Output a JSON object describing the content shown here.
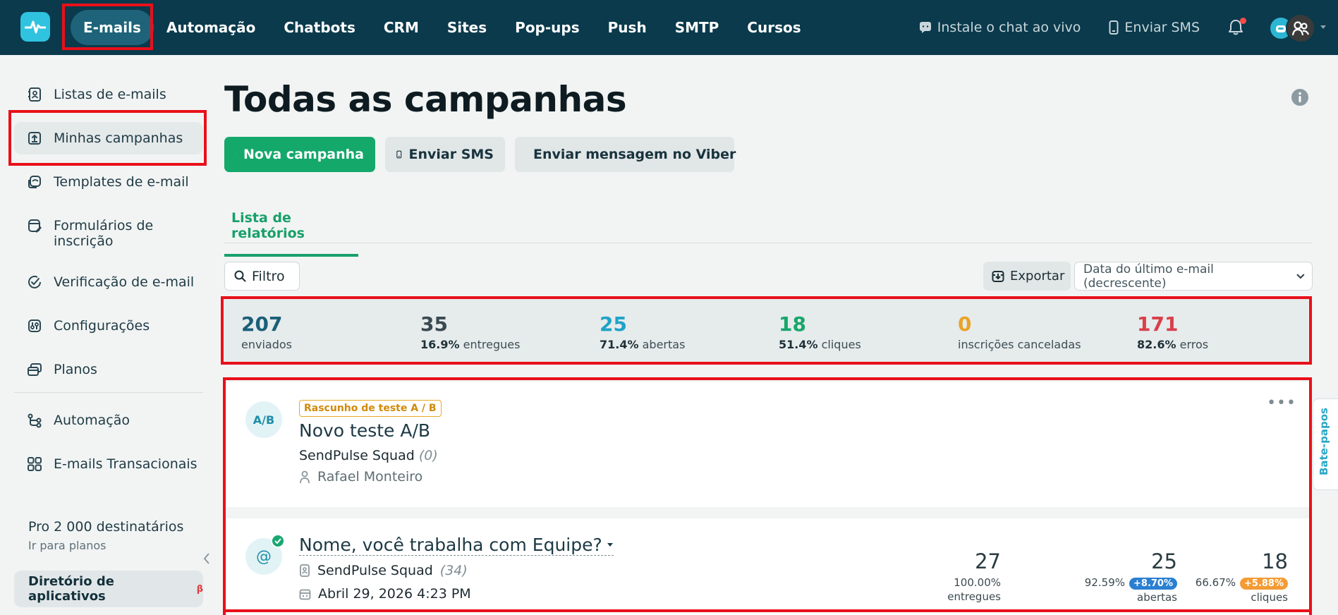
{
  "topbar": {
    "nav": [
      "E-mails",
      "Automação",
      "Chatbots",
      "CRM",
      "Sites",
      "Pop-ups",
      "Push",
      "SMTP",
      "Cursos"
    ],
    "live_chat": "Instale o chat ao vivo",
    "send_sms": "Enviar SMS"
  },
  "sidebar": {
    "items": [
      "Listas de e-mails",
      "Minhas campanhas",
      "Templates de e-mail",
      "Formulários de inscrição",
      "Verificação de e-mail",
      "Configurações",
      "Planos",
      "Automação",
      "E-mails Transacionais"
    ],
    "plan_name": "Pro 2 000 destinatários",
    "plan_link": "Ir para planos",
    "apps": "Diretório de aplicativos",
    "apps_badge": "β"
  },
  "main": {
    "title": "Todas as campanhas",
    "buttons": {
      "new_campaign": "Nova campanha",
      "send_sms": "Enviar SMS",
      "viber": "Enviar mensagem no Viber"
    },
    "tab": "Lista de relatórios",
    "filter": "Filtro",
    "export": "Exportar",
    "sort": "Data do último e-mail (decrescente)"
  },
  "stats": [
    {
      "value": "207",
      "pct": "",
      "label": "enviados",
      "color": "#1b5f78"
    },
    {
      "value": "35",
      "pct": "16.9%",
      "label": "entregues",
      "color": "#3a4a51"
    },
    {
      "value": "25",
      "pct": "71.4%",
      "label": "abertas",
      "color": "#1ea3c8"
    },
    {
      "value": "18",
      "pct": "51.4%",
      "label": "cliques",
      "color": "#17a66b"
    },
    {
      "value": "0",
      "pct": "",
      "label": "inscrições canceladas",
      "color": "#e9a326"
    },
    {
      "value": "171",
      "pct": "82.6%",
      "label": "erros",
      "color": "#d8404a"
    }
  ],
  "campaigns": [
    {
      "icon": "A/B",
      "badge": "Rascunho de teste A / B",
      "title": "Novo teste A/B",
      "sender": "SendPulse Squad",
      "count": "(0)",
      "author": "Rafael Monteiro"
    },
    {
      "icon": "@",
      "title": "Nome, você trabalha com Equipe?",
      "sender": "SendPulse Squad",
      "count": "(34)",
      "date": "Abril 29, 2026 4:23 PM",
      "metrics": [
        {
          "value": "27",
          "pct": "100.00%",
          "label": "entregues",
          "delta": "",
          "delta_color": ""
        },
        {
          "value": "25",
          "pct": "92.59%",
          "label": "abertas",
          "delta": "+8.70%",
          "delta_color": "#2b7fd1"
        },
        {
          "value": "18",
          "pct": "66.67%",
          "label": "cliques",
          "delta": "+5.88%",
          "delta_color": "#f39b35"
        }
      ]
    }
  ],
  "chat_tab": "Bate-papos"
}
